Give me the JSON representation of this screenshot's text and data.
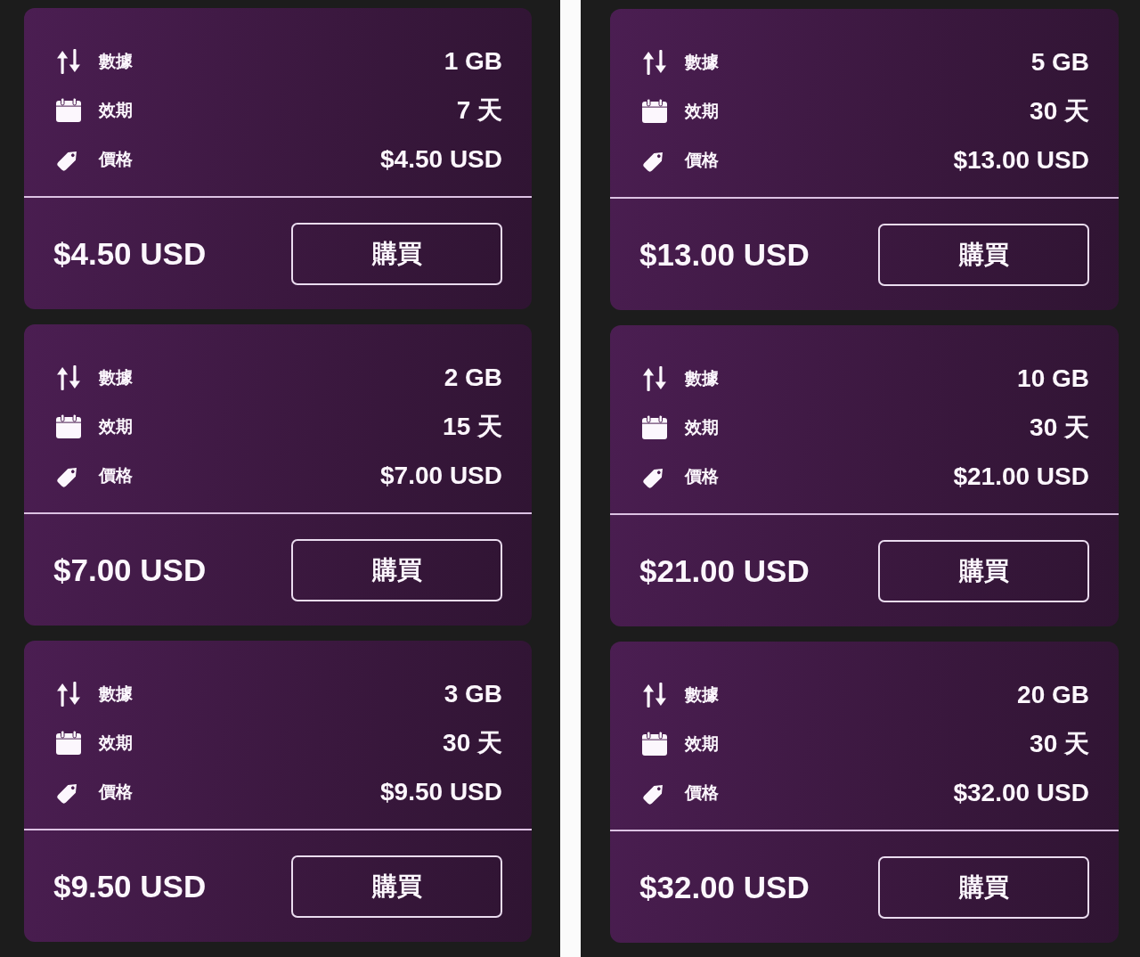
{
  "columns": [
    {
      "plans": [
        {
          "rows": [
            {
              "kind": "data",
              "label": "數據",
              "value": "1 GB"
            },
            {
              "kind": "validity",
              "label": "效期",
              "value": "7 天"
            },
            {
              "kind": "price",
              "label": "價格",
              "value": "$4.50 USD"
            }
          ],
          "total": "$4.50 USD",
          "button": "購買"
        },
        {
          "rows": [
            {
              "kind": "data",
              "label": "數據",
              "value": "2 GB"
            },
            {
              "kind": "validity",
              "label": "效期",
              "value": "15 天"
            },
            {
              "kind": "price",
              "label": "價格",
              "value": "$7.00 USD"
            }
          ],
          "total": "$7.00 USD",
          "button": "購買"
        },
        {
          "rows": [
            {
              "kind": "data",
              "label": "數據",
              "value": "3 GB"
            },
            {
              "kind": "validity",
              "label": "效期",
              "value": "30 天"
            },
            {
              "kind": "price",
              "label": "價格",
              "value": "$9.50 USD"
            }
          ],
          "total": "$9.50 USD",
          "button": "購買"
        }
      ]
    },
    {
      "plans": [
        {
          "rows": [
            {
              "kind": "data",
              "label": "數據",
              "value": "5 GB"
            },
            {
              "kind": "validity",
              "label": "效期",
              "value": "30 天"
            },
            {
              "kind": "price",
              "label": "價格",
              "value": "$13.00 USD"
            }
          ],
          "total": "$13.00 USD",
          "button": "購買"
        },
        {
          "rows": [
            {
              "kind": "data",
              "label": "數據",
              "value": "10 GB"
            },
            {
              "kind": "validity",
              "label": "效期",
              "value": "30 天"
            },
            {
              "kind": "price",
              "label": "價格",
              "value": "$21.00 USD"
            }
          ],
          "total": "$21.00 USD",
          "button": "購買"
        },
        {
          "rows": [
            {
              "kind": "data",
              "label": "數據",
              "value": "20 GB"
            },
            {
              "kind": "validity",
              "label": "效期",
              "value": "30 天"
            },
            {
              "kind": "price",
              "label": "價格",
              "value": "$32.00 USD"
            }
          ],
          "total": "$32.00 USD",
          "button": "購買"
        }
      ]
    }
  ]
}
